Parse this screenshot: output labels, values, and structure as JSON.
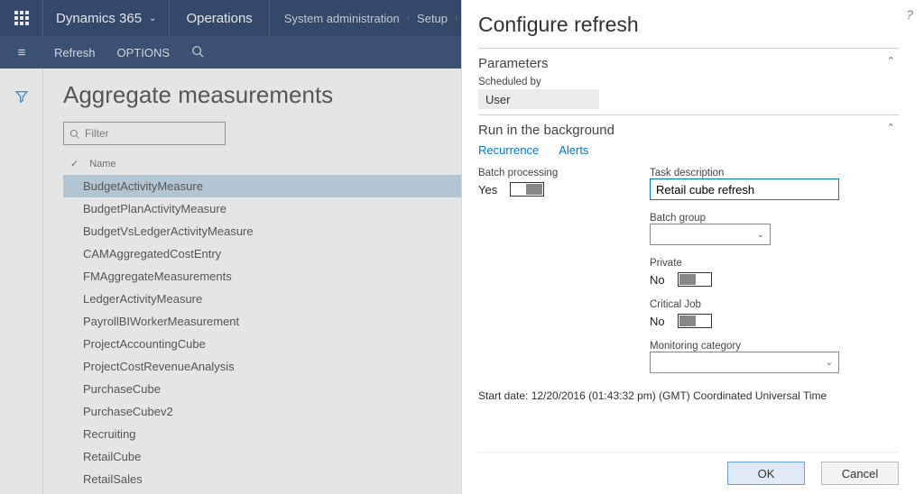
{
  "topbar": {
    "brand": "Dynamics 365",
    "module": "Operations",
    "crumb1": "System administration",
    "crumb2": "Setup"
  },
  "secbar": {
    "refresh": "Refresh",
    "options": "OPTIONS"
  },
  "page": {
    "title": "Aggregate measurements",
    "filter_placeholder": "Filter",
    "col_name": "Name"
  },
  "measurements": [
    "BudgetActivityMeasure",
    "BudgetPlanActivityMeasure",
    "BudgetVsLedgerActivityMeasure",
    "CAMAggregatedCostEntry",
    "FMAggregateMeasurements",
    "LedgerActivityMeasure",
    "PayrollBIWorkerMeasurement",
    "ProjectAccountingCube",
    "ProjectCostRevenueAnalysis",
    "PurchaseCube",
    "PurchaseCubev2",
    "Recruiting",
    "RetailCube",
    "RetailSales"
  ],
  "panel": {
    "title": "Configure refresh",
    "section_parameters": "Parameters",
    "scheduled_by_label": "Scheduled by",
    "scheduled_by_value": "User",
    "section_background": "Run in the background",
    "tab_recurrence": "Recurrence",
    "tab_alerts": "Alerts",
    "batch_processing_label": "Batch processing",
    "batch_processing_value": "Yes",
    "task_description_label": "Task description",
    "task_description_value": "Retail cube refresh",
    "batch_group_label": "Batch group",
    "private_label": "Private",
    "private_value": "No",
    "critical_job_label": "Critical Job",
    "critical_job_value": "No",
    "monitoring_category_label": "Monitoring category",
    "start_date": "Start date: 12/20/2016 (01:43:32 pm) (GMT) Coordinated Universal Time",
    "ok": "OK",
    "cancel": "Cancel"
  }
}
